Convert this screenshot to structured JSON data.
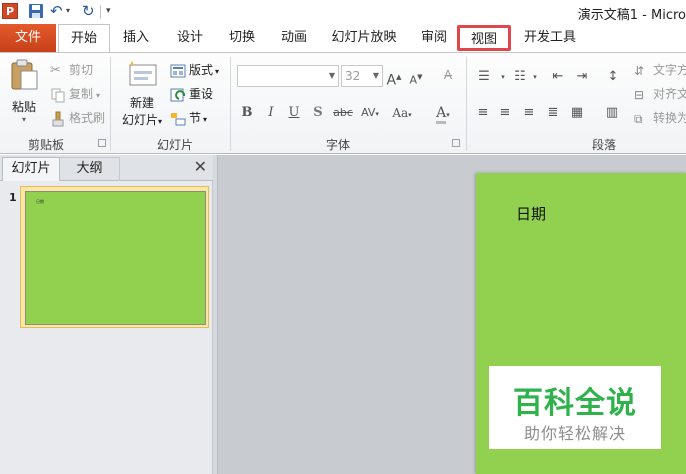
{
  "app": {
    "logo": "P",
    "window_title": "演示文稿1 - Micro"
  },
  "tabs": {
    "file": "文件",
    "home": "开始",
    "insert": "插入",
    "design": "设计",
    "transition": "切换",
    "animation": "动画",
    "slideshow": "幻灯片放映",
    "review": "审阅",
    "view": "视图",
    "developer": "开发工具"
  },
  "clipboard": {
    "paste": "粘贴",
    "cut": "剪切",
    "copy": "复制",
    "format_painter": "格式刷",
    "label": "剪贴板"
  },
  "slides_group": {
    "new_slide_1": "新建",
    "new_slide_2": "幻灯片",
    "layout": "版式",
    "reset": "重设",
    "section": "节",
    "label": "幻灯片"
  },
  "font_group": {
    "font_name": "",
    "font_size": "32",
    "bold": "B",
    "italic": "I",
    "underline": "U",
    "shadow": "S",
    "strikethrough": "abc",
    "spacing": "AV",
    "case": "Aa",
    "font_color": "A",
    "grow": "A",
    "shrink": "A",
    "label": "字体"
  },
  "paragraph_group": {
    "text_direction": "文字方",
    "align_text": "对齐文",
    "convert": "转换为",
    "label": "段落"
  },
  "pane": {
    "tab_slides": "幻灯片",
    "tab_outline": "大纲",
    "close": "✕",
    "slide_number": "1",
    "thumb_text": "日期"
  },
  "slide": {
    "text": "日期"
  },
  "watermark": {
    "title": "百科全说",
    "subtitle": "助你轻松解决"
  },
  "colors": {
    "slide_bg": "#92d050",
    "file_tab": "#d24726",
    "highlight": "#e0474c",
    "watermark_green": "#2fb24c"
  }
}
